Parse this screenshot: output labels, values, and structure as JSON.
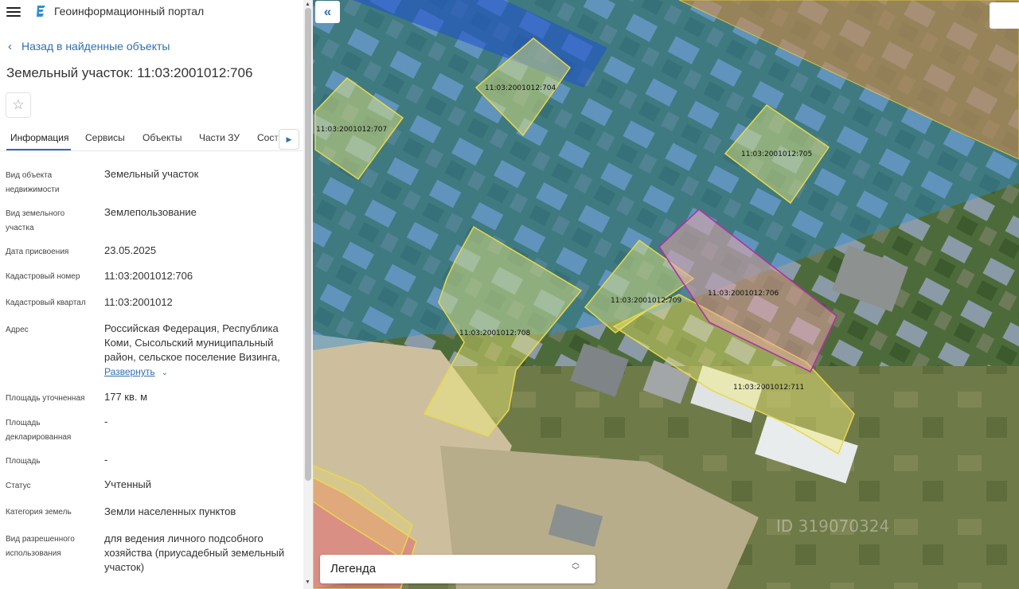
{
  "app": {
    "title": "Геоинформационный портал"
  },
  "nav": {
    "back_label": "Назад в найденные объекты"
  },
  "object": {
    "title": "Земельный участок: 11:03:2001012:706"
  },
  "tabs": [
    {
      "label": "Информация",
      "active": true
    },
    {
      "label": "Сервисы"
    },
    {
      "label": "Объекты"
    },
    {
      "label": "Части ЗУ"
    },
    {
      "label": "Состав"
    }
  ],
  "details": [
    {
      "label": "Вид объекта недвижимости",
      "value": "Земельный участок"
    },
    {
      "label": "Вид земельного участка",
      "value": "Землепользование"
    },
    {
      "label": "Дата присвоения",
      "value": "23.05.2025"
    },
    {
      "label": "Кадастровый номер",
      "value": "11:03:2001012:706"
    },
    {
      "label": "Кадастровый квартал",
      "value": "11:03:2001012"
    },
    {
      "label": "Адрес",
      "value": "Российская Федерация, Республика Коми, Сысольский муниципальный район, сельское поселение Визинга,",
      "expand_label": "Развернуть"
    },
    {
      "label": "Площадь уточненная",
      "value": "177 кв. м"
    },
    {
      "label": "Площадь декларированная",
      "value": "-"
    },
    {
      "label": "Площадь",
      "value": "-"
    },
    {
      "label": "Статус",
      "value": "Учтенный"
    },
    {
      "label": "Категория земель",
      "value": "Земли населенных пунктов"
    },
    {
      "label": "Вид разрешенного использования",
      "value": "для ведения личного подсобного хозяйства (приусадебный земельный участок)"
    }
  ],
  "map": {
    "legend_label": "Легенда",
    "watermark": "ID 319070324",
    "parcels": [
      {
        "label": "11:03:2001012:704"
      },
      {
        "label": "11:03:2001012:707"
      },
      {
        "label": "11:03:2001012:705"
      },
      {
        "label": "11:03:2001012:709"
      },
      {
        "label": "11:03:2001012:706",
        "selected": true
      },
      {
        "label": "11:03:2001012:708"
      },
      {
        "label": "11:03:2001012:711"
      }
    ]
  },
  "colors": {
    "accent": "#2f6fb3",
    "parcel_fill": "#f2ee7a",
    "parcel_stroke": "#e8d84a",
    "selected_fill": "#e8a6a6",
    "selected_stroke": "#b02fa8",
    "zone_blue": "#2f8fd6",
    "zone_orange": "#e08a3a"
  },
  "icons": [
    "menu-icon",
    "logo-icon",
    "chevron-left-icon",
    "star-icon",
    "chevron-right-icon",
    "double-chevron-left-icon",
    "sort-arrows-icon"
  ]
}
